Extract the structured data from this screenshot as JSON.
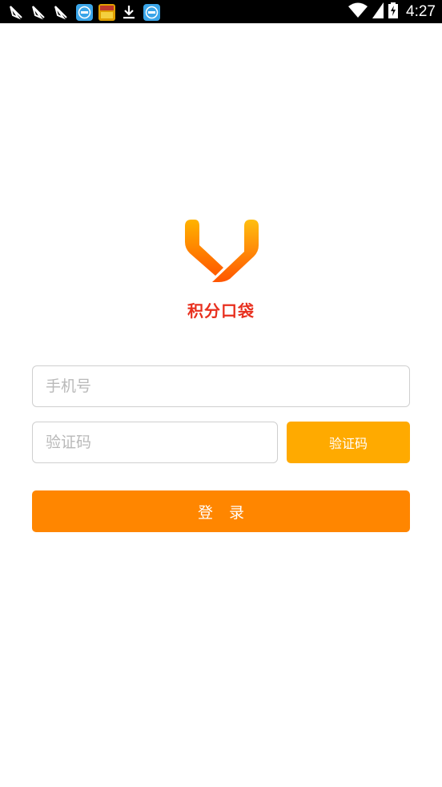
{
  "status_bar": {
    "time": "4:27",
    "left_icons": [
      "notification-icon",
      "notification-icon",
      "notification-icon",
      "fox-browser-icon",
      "game-icon",
      "download-icon",
      "fox-browser-icon"
    ],
    "right_icons": [
      "wifi-icon",
      "signal-icon",
      "battery-charging-icon"
    ]
  },
  "app": {
    "name": "积分口袋",
    "brand_color": "#e8301f",
    "logo_colors": [
      "#ffb300",
      "#ff6a00"
    ]
  },
  "form": {
    "phone_placeholder": "手机号",
    "code_placeholder": "验证码",
    "code_button_label": "验证码",
    "login_button_label": "登录",
    "code_button_color": "#ffaa00",
    "login_button_color": "#ff8600"
  }
}
